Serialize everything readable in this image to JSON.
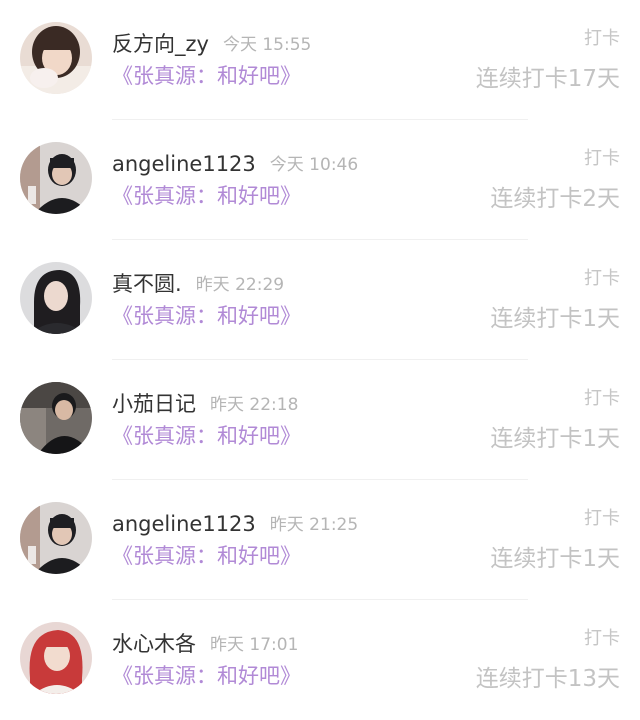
{
  "items": [
    {
      "name": "反方向_zy",
      "time": "今天 15:55",
      "title": "《张真源：和好吧》",
      "action": "打卡",
      "streak": "连续打卡17天"
    },
    {
      "name": "angeline1123",
      "time": "今天 10:46",
      "title": "《张真源：和好吧》",
      "action": "打卡",
      "streak": "连续打卡2天"
    },
    {
      "name": "真不圆.",
      "time": "昨天 22:29",
      "title": "《张真源：和好吧》",
      "action": "打卡",
      "streak": "连续打卡1天"
    },
    {
      "name": "小茄日记",
      "time": "昨天 22:18",
      "title": "《张真源：和好吧》",
      "action": "打卡",
      "streak": "连续打卡1天"
    },
    {
      "name": "angeline1123",
      "time": "昨天 21:25",
      "title": "《张真源：和好吧》",
      "action": "打卡",
      "streak": "连续打卡1天"
    },
    {
      "name": "水心木各",
      "time": "昨天 17:01",
      "title": "《张真源：和好吧》",
      "action": "打卡",
      "streak": "连续打卡13天"
    }
  ],
  "colors": {
    "title_accent": "#b18ad6",
    "meta_gray": "#b5b5b5"
  }
}
